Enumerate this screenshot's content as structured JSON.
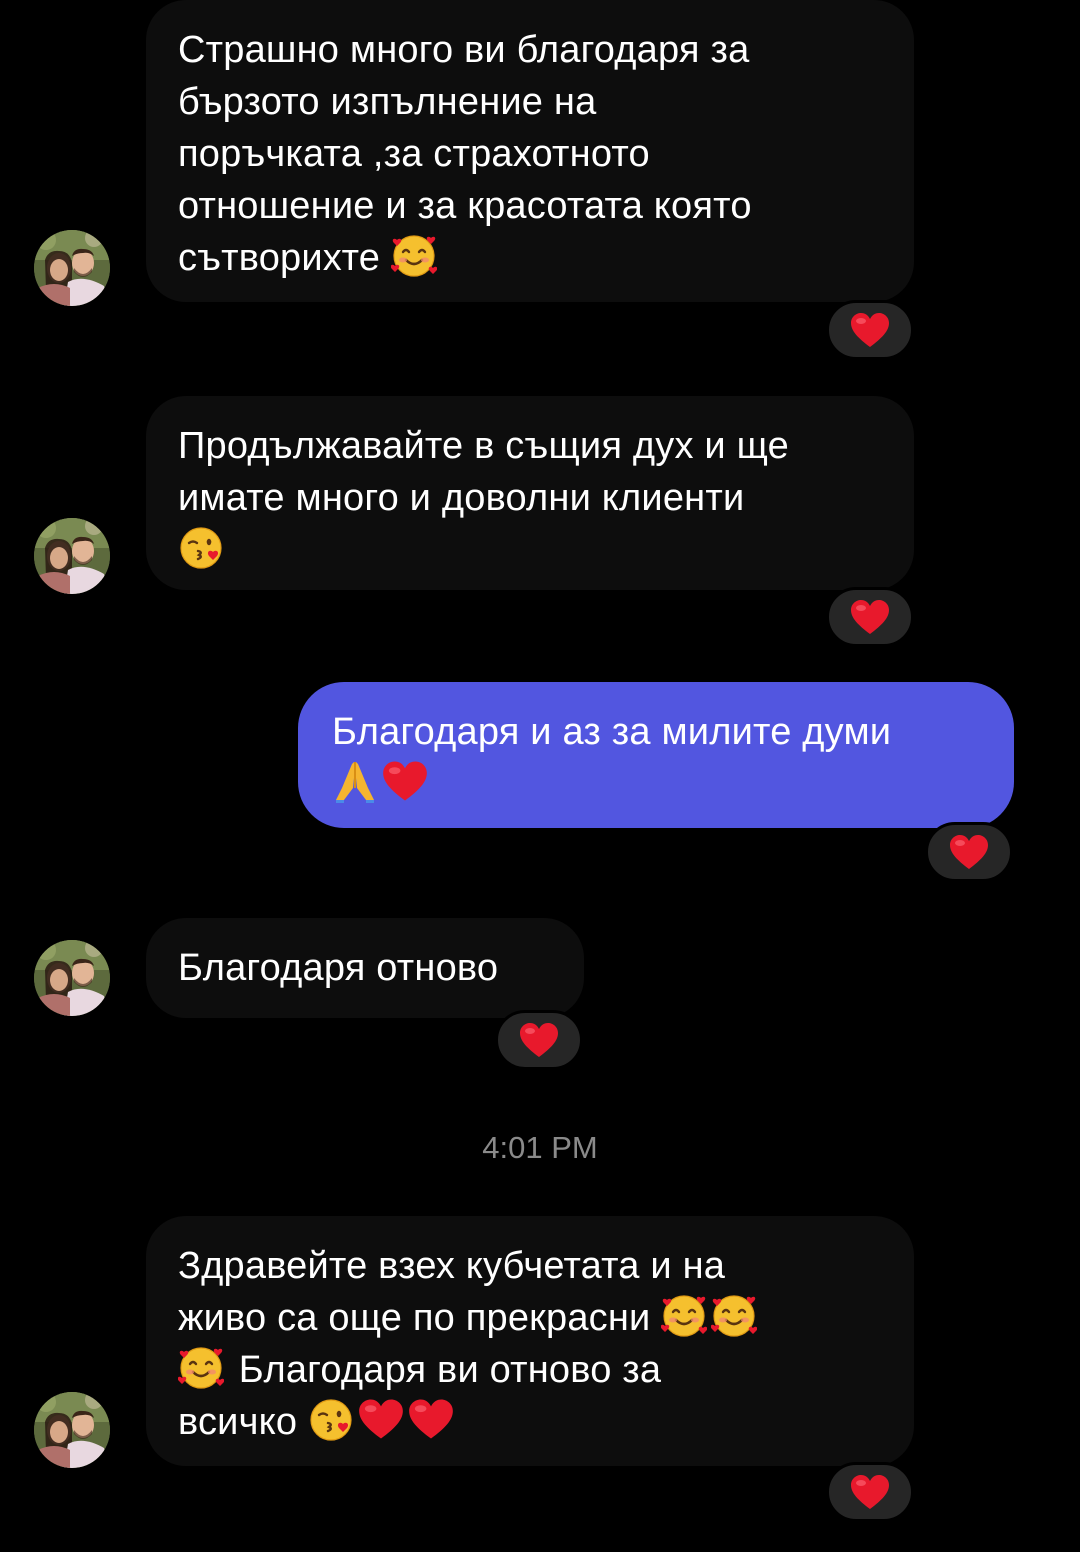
{
  "messages": [
    {
      "direction": "incoming",
      "lines": [
        "Страшно много ви благодаря за",
        "бързото изпълнение на",
        "поръчката ,за страхотното",
        "отношение и за красотата която",
        "сътворихте"
      ],
      "emojis": [
        "smiling-face-with-hearts"
      ],
      "reaction": "red-heart"
    },
    {
      "direction": "incoming",
      "lines": [
        "Продължавайте в същия дух и ще",
        "имате много и доволни клиенти"
      ],
      "emojis": [
        "face-blowing-kiss"
      ],
      "reaction": "red-heart"
    },
    {
      "direction": "outgoing",
      "lines": [
        "Благодаря и аз за милите думи"
      ],
      "emojis": [
        "folded-hands",
        "red-heart"
      ],
      "reaction": "red-heart"
    },
    {
      "direction": "incoming",
      "lines": [
        "Благодаря отново"
      ],
      "reaction": "red-heart"
    },
    {
      "direction": "incoming",
      "lines": [
        "Здравейте взех кубчетата и на",
        "живо са още по прекрасни",
        "Благодаря ви отново за",
        "всичко"
      ],
      "emojis": [
        "smiling-face-with-hearts",
        "smiling-face-with-hearts",
        "smiling-face-with-hearts",
        "face-blowing-kiss",
        "red-heart",
        "red-heart"
      ],
      "reaction": "red-heart"
    }
  ],
  "timestamp": "4:01 PM",
  "colors": {
    "background": "#000000",
    "incoming_bubble": "#0d0d0d",
    "outgoing_bubble": "#5256e0",
    "reaction_pill": "#262626",
    "heart": "#e8192c",
    "timestamp_text": "#8a8a8a"
  }
}
